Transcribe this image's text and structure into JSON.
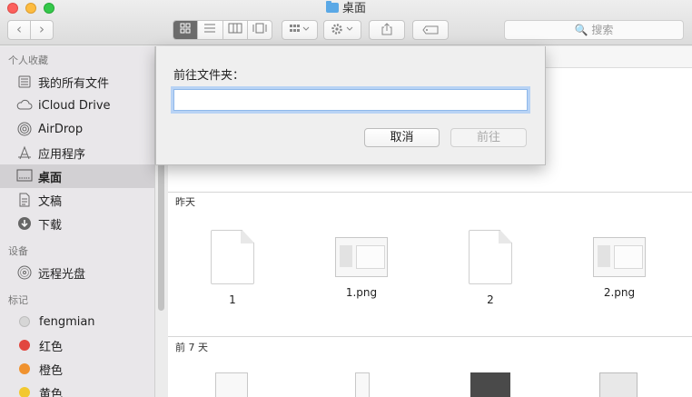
{
  "window": {
    "title": "桌面"
  },
  "toolbar": {
    "back": "‹",
    "forward": "›",
    "views": [
      "icon",
      "list",
      "columns",
      "coverflow"
    ],
    "search_placeholder": "🔍 搜索"
  },
  "sidebar": {
    "favorites_header": "个人收藏",
    "favorites": [
      {
        "label": "我的所有文件",
        "icon": "all-files-icon"
      },
      {
        "label": "iCloud Drive",
        "icon": "cloud-icon"
      },
      {
        "label": "AirDrop",
        "icon": "airdrop-icon"
      },
      {
        "label": "应用程序",
        "icon": "applications-icon"
      },
      {
        "label": "桌面",
        "icon": "desktop-icon",
        "selected": true
      },
      {
        "label": "文稿",
        "icon": "documents-icon"
      },
      {
        "label": "下载",
        "icon": "downloads-icon"
      }
    ],
    "devices_header": "设备",
    "devices": [
      {
        "label": "远程光盘",
        "icon": "disc-icon"
      }
    ],
    "tags_header": "标记",
    "tags": [
      {
        "label": "fengmian",
        "color": "#d0d0d0"
      },
      {
        "label": "红色",
        "color": "#e2463f"
      },
      {
        "label": "橙色",
        "color": "#f0922f"
      },
      {
        "label": "黄色",
        "color": "#f2c830"
      }
    ]
  },
  "content": {
    "sections": [
      {
        "title": "昨天",
        "files": [
          {
            "name": "1",
            "kind": "doc"
          },
          {
            "name": "1.png",
            "kind": "png"
          },
          {
            "name": "2",
            "kind": "doc"
          },
          {
            "name": "2.png",
            "kind": "png"
          }
        ]
      },
      {
        "title": "前 7 天"
      }
    ]
  },
  "dialog": {
    "label": "前往文件夹：",
    "input_value": "",
    "cancel": "取消",
    "go": "前往"
  }
}
